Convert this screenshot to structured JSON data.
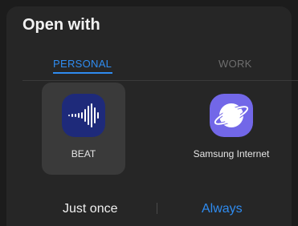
{
  "dialog": {
    "title": "Open with"
  },
  "tabs": [
    {
      "label": "PERSONAL",
      "active": true
    },
    {
      "label": "WORK",
      "active": false
    }
  ],
  "apps": [
    {
      "name": "BEAT",
      "icon": "beat-waveform-icon",
      "selected": true
    },
    {
      "name": "Samsung Internet",
      "icon": "samsung-internet-icon",
      "selected": false
    }
  ],
  "actions": {
    "just_once": "Just once",
    "always": "Always"
  },
  "colors": {
    "accent": "#2f8cf0",
    "sheet": "#262626",
    "beat_icon_bg": "#1e2a7a",
    "internet_icon_bg": "#7267e8"
  }
}
